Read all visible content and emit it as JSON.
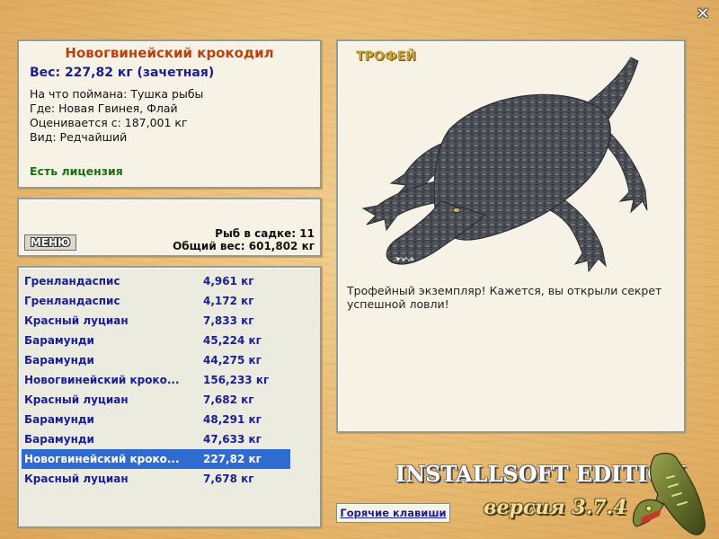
{
  "fish": {
    "name": "Новогвинейский крокодил",
    "weight": "Вес: 227,82 кг (зачетная)",
    "bait": "На что поймана: Тушка рыбы",
    "location": "Где: Новая Гвинея, Флай",
    "valued_from": "Оценивается с: 187,001 кг",
    "kind": "Вид: Редчайший",
    "license": "Есть лицензия"
  },
  "keepnet": {
    "menu_label": "МЕНЮ",
    "count": "Рыб в садке: 11",
    "total_weight": "Общий вес: 601,802 кг"
  },
  "catch_list": [
    {
      "name": "Гренландаспис",
      "weight": "4,961 кг"
    },
    {
      "name": "Гренландаспис",
      "weight": "4,172 кг"
    },
    {
      "name": "Красный луциан",
      "weight": "7,833 кг"
    },
    {
      "name": "Барамунди",
      "weight": "45,224 кг"
    },
    {
      "name": "Барамунди",
      "weight": "44,275 кг"
    },
    {
      "name": "Новогвинейский кроко...",
      "weight": "156,233 кг"
    },
    {
      "name": "Красный луциан",
      "weight": "7,682 кг"
    },
    {
      "name": "Барамунди",
      "weight": "48,291 кг"
    },
    {
      "name": "Барамунди",
      "weight": "47,633 кг"
    },
    {
      "name": "Новогвинейский кроко...",
      "weight": "227,82 кг",
      "selected": true
    },
    {
      "name": "Красный луциан",
      "weight": "7,678 кг"
    }
  ],
  "trophy": {
    "label": "ТРОФЕЙ",
    "text": "Трофейный экземпляр! Кажется, вы открыли секрет успешной ловли!"
  },
  "footer": {
    "hotkeys_label": "Горячие клавиши",
    "edition": "INSTALLSOFT EDITION",
    "version": "версия 3.7.4"
  },
  "icons": {
    "close": "close-icon",
    "trophy_image": "crocodile-image",
    "logo": "pike-logo-icon"
  },
  "colors": {
    "title": "#b8410e",
    "accent_blue": "#1b1e8f",
    "license_green": "#1c6e12",
    "selection": "#2f6bd1",
    "trophy_gold": "#caa23a"
  }
}
